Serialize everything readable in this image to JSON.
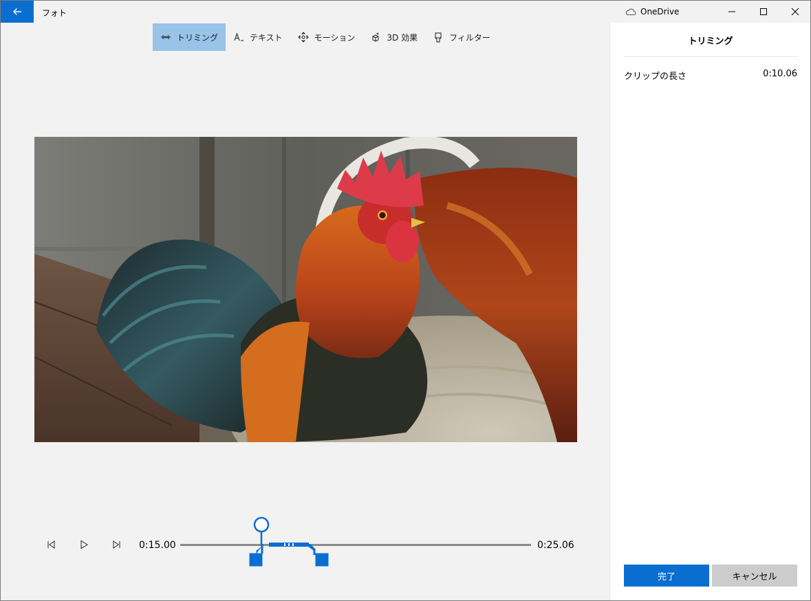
{
  "titlebar": {
    "app_title": "フォト",
    "onedrive_label": "OneDrive"
  },
  "toolbar": {
    "items": [
      {
        "label": "トリミング",
        "icon": "trim-icon",
        "active": true
      },
      {
        "label": "テキスト",
        "icon": "text-icon",
        "active": false
      },
      {
        "label": "モーション",
        "icon": "motion-icon",
        "active": false
      },
      {
        "label": "3D 効果",
        "icon": "3d-effects-icon",
        "active": false
      },
      {
        "label": "フィルター",
        "icon": "filter-icon",
        "active": false
      }
    ]
  },
  "panel": {
    "title": "トリミング",
    "clip_length_label": "クリップの長さ",
    "clip_length_value": "0:10.06",
    "done_label": "完了",
    "cancel_label": "キャンセル"
  },
  "timeline": {
    "start_time": "0:15.00",
    "end_time": "0:25.06"
  },
  "colors": {
    "accent": "#0a6ed1",
    "active_tool_bg": "#99c3e8",
    "window_bg": "#f2f2f2",
    "panel_bg": "#ffffff"
  }
}
